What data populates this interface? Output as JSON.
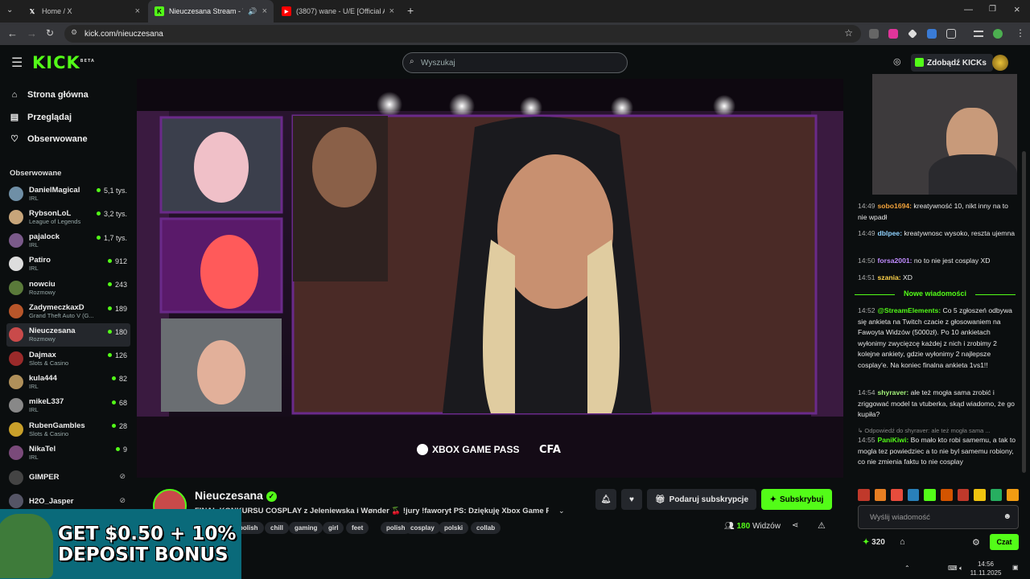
{
  "browser": {
    "tabs": [
      {
        "title": "Home / X"
      },
      {
        "title": "Nieuczesana Stream - Watc"
      },
      {
        "title": "(3807) wane - U/E [Official Audi"
      }
    ],
    "url": "kick.com/nieuczesana"
  },
  "header": {
    "logo": "KICK",
    "logo_badge": "BETA",
    "search_placeholder": "Wyszukaj",
    "get_kicks": "Zdobądź KICKs"
  },
  "sidebar": {
    "nav": [
      {
        "label": "Strona główna",
        "icon": "home-icon"
      },
      {
        "label": "Przeglądaj",
        "icon": "browse-icon"
      },
      {
        "label": "Obserwowane",
        "icon": "heart-icon"
      }
    ],
    "following_title": "Obserwowane",
    "channels": [
      {
        "name": "DanielMagical",
        "category": "IRL",
        "viewers": "5,1 tys.",
        "color": "#6f8fa6"
      },
      {
        "name": "RybsonLoL",
        "category": "League of Legends",
        "viewers": "3,2 tys.",
        "color": "#c7a57a"
      },
      {
        "name": "pajalock",
        "category": "IRL",
        "viewers": "1,7 tys.",
        "color": "#7a5a8a"
      },
      {
        "name": "Patiro",
        "category": "IRL",
        "viewers": "912",
        "color": "#ddd"
      },
      {
        "name": "nowciu",
        "category": "Rozmowy",
        "viewers": "243",
        "color": "#5a7a3a"
      },
      {
        "name": "ZadymeczkaxD",
        "category": "Grand Theft Auto V (G...",
        "viewers": "189",
        "color": "#b8562a"
      },
      {
        "name": "Nieuczesana",
        "category": "Rozmowy",
        "viewers": "180",
        "color": "#c94a4a"
      },
      {
        "name": "Dajmax",
        "category": "Slots & Casino",
        "viewers": "126",
        "color": "#9a2a2a"
      },
      {
        "name": "kula444",
        "category": "IRL",
        "viewers": "82",
        "color": "#b0905a"
      },
      {
        "name": "mikeL337",
        "category": "IRL",
        "viewers": "68",
        "color": "#888"
      },
      {
        "name": "RubenGambles",
        "category": "Slots & Casino",
        "viewers": "28",
        "color": "#c9a02a"
      },
      {
        "name": "NikaTel",
        "category": "IRL",
        "viewers": "9",
        "color": "#7a4a7a"
      }
    ],
    "offline": [
      {
        "name": "GIMPER",
        "color": "#444"
      },
      {
        "name": "H2O_Jasper",
        "color": "#556"
      }
    ]
  },
  "video": {
    "sponsor_1": "XBOX GAME PASS",
    "sponsor_2": "CFA"
  },
  "stream": {
    "name": "Nieuczesana",
    "title": "FINAŁ KONKURSU COSPLAY z Jeleniewska i Wønder 🍒 !jury !faworyt PS: Dziękuję Xbox Game P...",
    "tags": [
      "polish",
      "chill",
      "gaming",
      "girl",
      "feet",
      "polish",
      "cosplay",
      "polski",
      "collab"
    ],
    "subscribe_gift": "Podaruj subskrypcje",
    "subscribe": "Subskrybuj",
    "viewers_count": "180",
    "viewers_label": "Widzów"
  },
  "chat": {
    "messages": [
      {
        "time": "14:49",
        "user": "sobo1694",
        "color": "#f2a23a",
        "text": "kreatywność 10, nikt inny na to nie wpadł"
      },
      {
        "time": "14:49",
        "user": "dblpee",
        "color": "#8fd1ff",
        "text": "kreatywnosc wysoko, reszta ujemna"
      },
      {
        "time": "14:50",
        "user": "forsa2001",
        "color": "#c08cff",
        "text": "no to nie jest cosplay XD"
      },
      {
        "time": "14:51",
        "user": "szania",
        "color": "#ffd24a",
        "text": "XD"
      }
    ],
    "new_messages": "Nowe wiadomości",
    "messages2": [
      {
        "time": "14:52",
        "user": "@StreamElements",
        "color": "#53fc18",
        "text": "Co 5 zgłoszeń odbywa się ankieta na Twitch czacie z głosowaniem na Fawoyta Widzów (5000zł). Po 10 ankietach wyłonimy zwycięzcę każdej z nich i zrobimy 2 kolejne ankiety, gdzie wyłonimy 2 najlepsze cosplay'e. Na koniec finalna ankieta 1vs1!!"
      },
      {
        "time": "14:54",
        "user": "shyraver",
        "color": "#a3f27a",
        "text": "ale też mogła sama zrobić i zriggować model ta vtuberka, skąd wiadomo, że go kupiła?"
      }
    ],
    "reply_ref": "Odpowiedź do shyraver: ale też mogła sama ...",
    "messages3": [
      {
        "time": "14:55",
        "user": "PaniKiwi",
        "color": "#53fc18",
        "text": "Bo mało kto robi samemu, a tak to mogla tez powiedziec a to nie byl samemu robiony, co nie zmienia faktu to nie cosplay"
      }
    ],
    "input_placeholder": "Wyślij wiadomość",
    "points": "320",
    "send": "Czat"
  },
  "ad": {
    "text_line1": "GET $0.50 + 10%",
    "text_line2": "DEPOSIT BONUS"
  },
  "taskbar": {
    "time": "14:56",
    "date": "11.11.2025"
  }
}
